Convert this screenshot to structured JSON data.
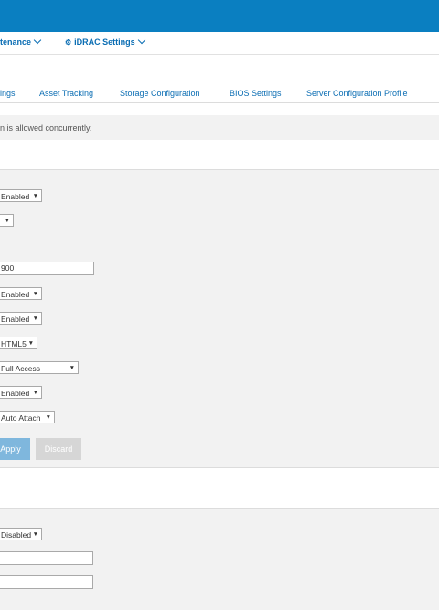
{
  "nav": {
    "maintenance_label": "tenance",
    "idrac_settings_label": "iDRAC Settings",
    "gear_glyph": "⚙"
  },
  "tabs": [
    "ings",
    "Asset Tracking",
    "Storage Configuration",
    "BIOS Settings",
    "Server Configuration Profile"
  ],
  "notice": "n is allowed concurrently.",
  "form": {
    "selects": [
      "Enabled",
      "",
      "Enabled",
      "Enabled",
      "HTML5",
      "Full Access",
      "Enabled",
      "Auto Attach"
    ],
    "text_value": "900",
    "apply_label": "Apply",
    "discard_label": "Discard"
  },
  "form2": {
    "select": "Disabled",
    "text1": "",
    "text2": ""
  },
  "colors": {
    "header_blue": "#0a7fc1",
    "link_blue": "#0a6db3",
    "apply_blue": "#7fb7dd",
    "panel_gray": "#f2f2f2"
  }
}
